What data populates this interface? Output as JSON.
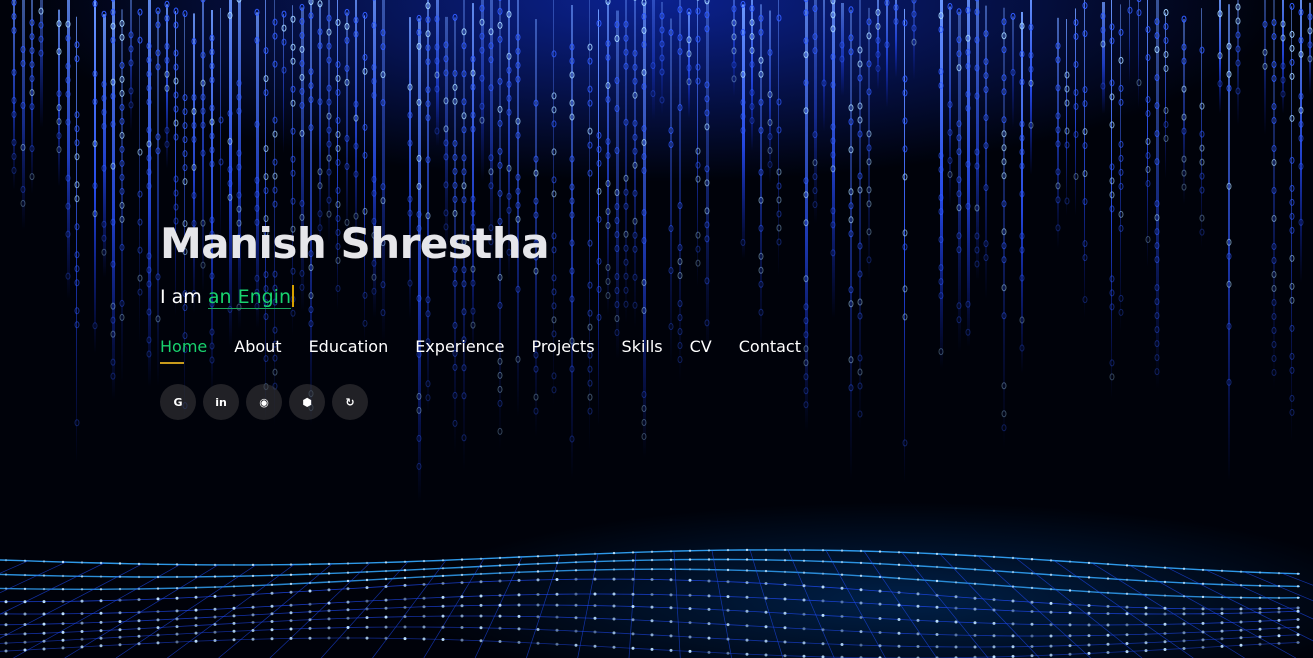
{
  "hero": {
    "name": "Manish Shrestha",
    "tagline_prefix": "I am ",
    "tagline_typed": "an Engin"
  },
  "nav": {
    "items": [
      {
        "label": "Home",
        "active": true
      },
      {
        "label": "About",
        "active": false
      },
      {
        "label": "Education",
        "active": false
      },
      {
        "label": "Experience",
        "active": false
      },
      {
        "label": "Projects",
        "active": false
      },
      {
        "label": "Skills",
        "active": false
      },
      {
        "label": "CV",
        "active": false
      },
      {
        "label": "Contact",
        "active": false
      }
    ]
  },
  "socials": [
    {
      "icon": "google-icon",
      "glyph": "G"
    },
    {
      "icon": "linkedin-icon",
      "glyph": "in"
    },
    {
      "icon": "github-icon",
      "glyph": "◉"
    },
    {
      "icon": "hexagon-icon",
      "glyph": "⬢"
    },
    {
      "icon": "leetcode-icon",
      "glyph": "↻"
    }
  ],
  "colors": {
    "accent": "#18d26e",
    "underline": "#c79a1c",
    "cursor": "#d6a000",
    "rain": "#2f5bff",
    "background": "#00020a"
  }
}
